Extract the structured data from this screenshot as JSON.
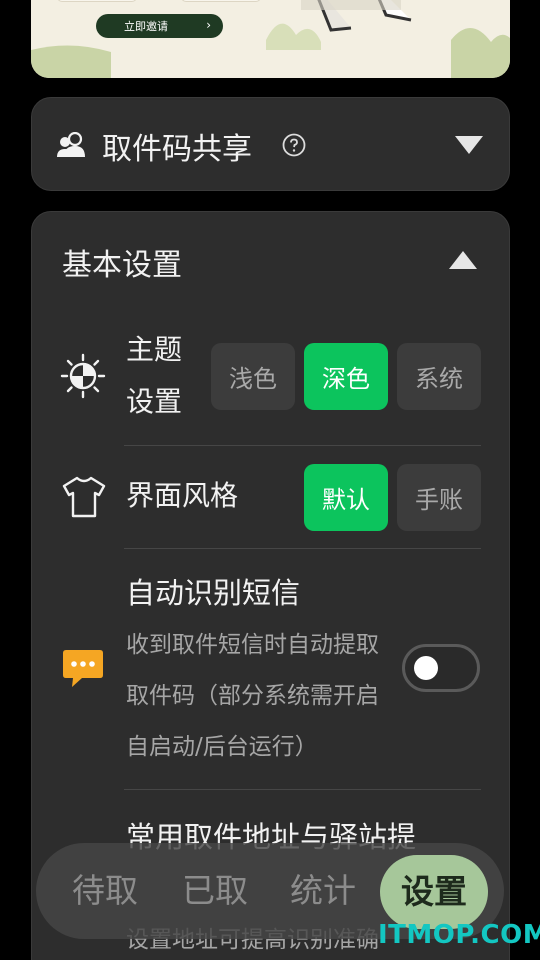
{
  "banner": {
    "invite_label": "立即邀请",
    "chevron": "›"
  },
  "share": {
    "title": "取件码共享",
    "icon": "people-icon",
    "help_icon": "question-circle-icon",
    "expand_icon": "triangle-down-icon"
  },
  "basic": {
    "title": "基本设置",
    "collapse_icon": "triangle-up-icon",
    "theme": {
      "label_line1": "主题",
      "label_line2": "设置",
      "icon": "sun-moon-icon",
      "options": [
        "浅色",
        "深色",
        "系统"
      ],
      "selected": "深色"
    },
    "style": {
      "label": "界面风格",
      "icon": "tshirt-icon",
      "options": [
        "默认",
        "手账"
      ],
      "selected": "默认"
    },
    "sms": {
      "title": "自动识别短信",
      "desc": "收到取件短信时自动提取取件码（部分系统需开启自启动/后台运行）",
      "icon": "chat-bubble-icon",
      "enabled": false
    },
    "address": {
      "title": "常用取件地址与驿站提",
      "desc": "设置地址可提高识别准确"
    }
  },
  "nav": {
    "items": [
      "待取",
      "已取",
      "统计",
      "设置"
    ],
    "active": "设置"
  },
  "watermark": "ITMOP.COM",
  "colors": {
    "background": "#000000",
    "card": "#2d2d2d",
    "accent_green": "#0cc45d",
    "nav_active": "#a6c79a",
    "sms_icon": "#f5a623",
    "watermark": "#13c7c2"
  }
}
